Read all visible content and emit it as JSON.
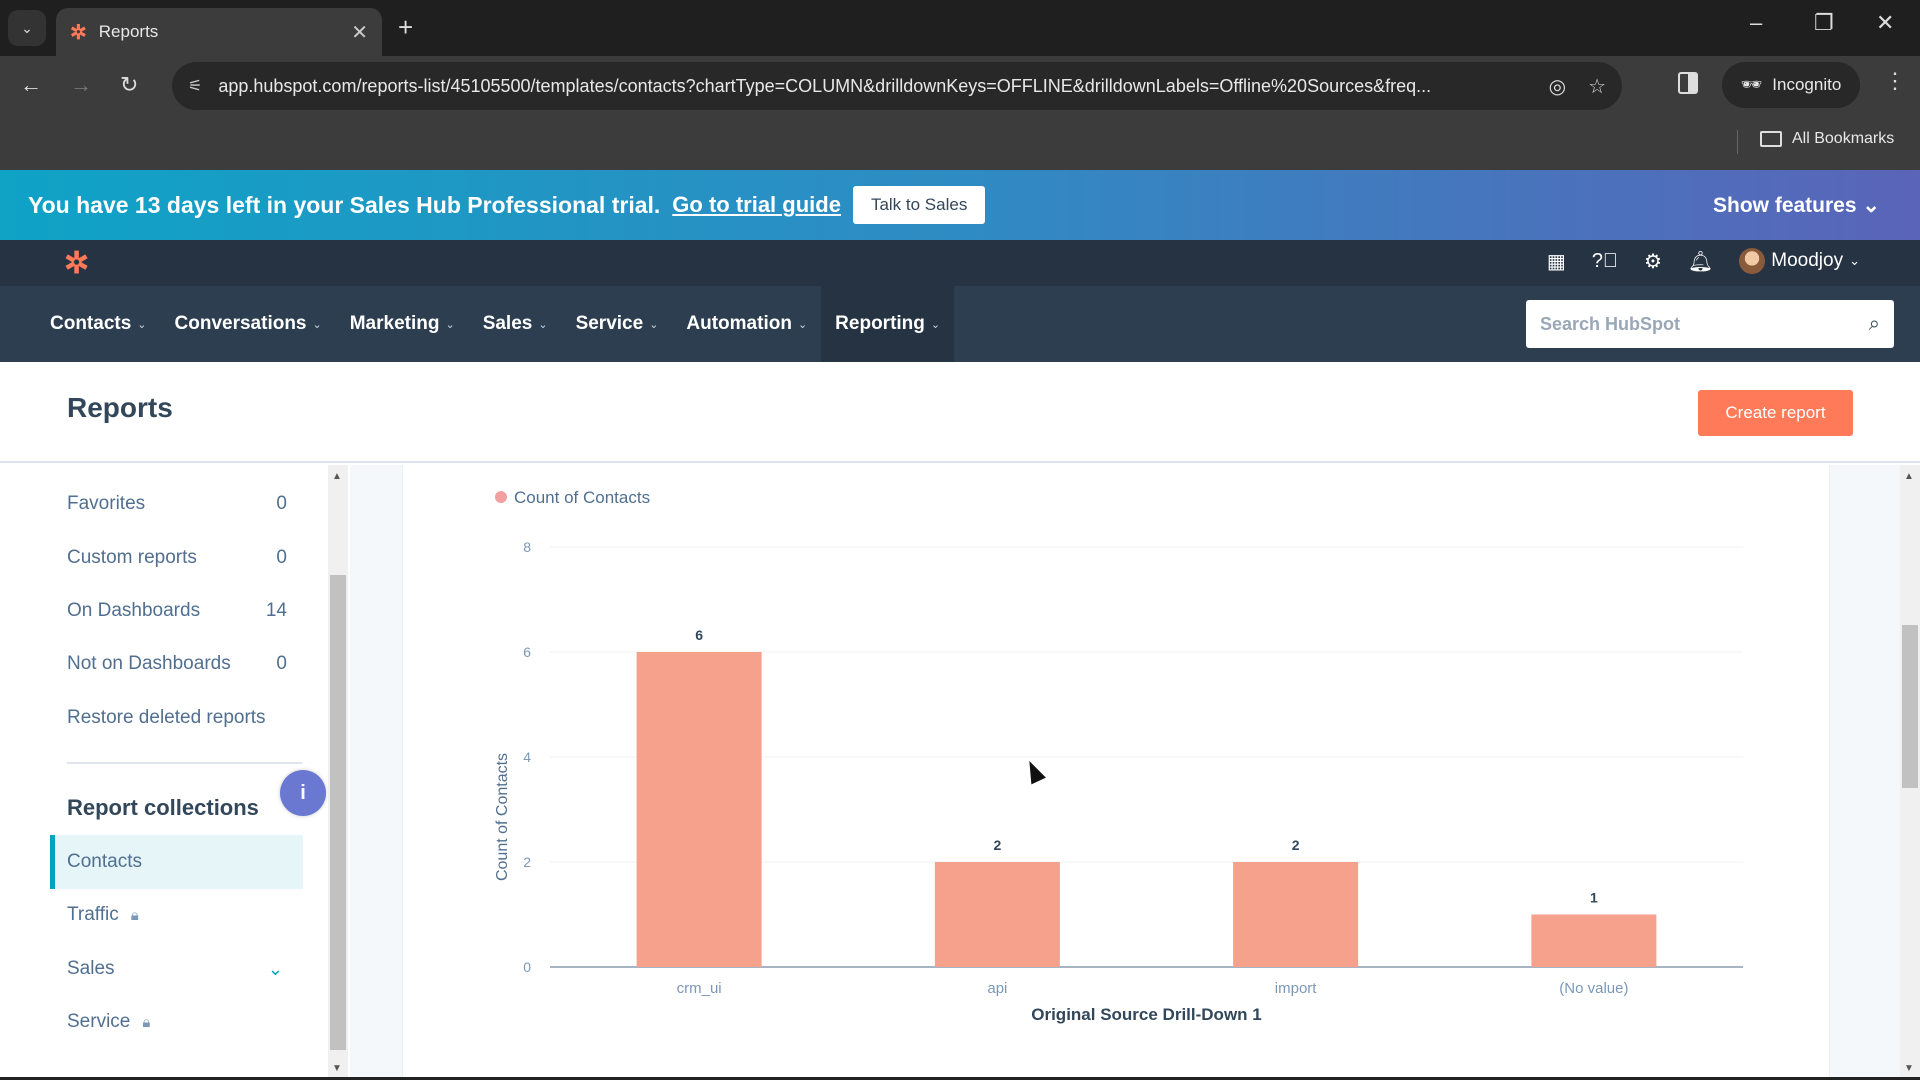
{
  "browser": {
    "tab_title": "Reports",
    "url": "app.hubspot.com/reports-list/45105500/templates/contacts?chartType=COLUMN&drilldownKeys=OFFLINE&drilldownLabels=Offline%20Sources&freq...",
    "incognito_label": "Incognito",
    "bookmarks_label": "All Bookmarks"
  },
  "trial_banner": {
    "message": "You have 13 days left in your Sales Hub Professional trial.",
    "guide_link": "Go to trial guide",
    "talk_button": "Talk to Sales",
    "show_features": "Show features"
  },
  "topbar": {
    "user_name": "Moodjoy"
  },
  "nav": {
    "items": [
      {
        "label": "Contacts"
      },
      {
        "label": "Conversations"
      },
      {
        "label": "Marketing"
      },
      {
        "label": "Sales"
      },
      {
        "label": "Service"
      },
      {
        "label": "Automation"
      },
      {
        "label": "Reporting"
      }
    ],
    "search_placeholder": "Search HubSpot"
  },
  "page": {
    "title": "Reports",
    "create_button": "Create report"
  },
  "sidebar": {
    "filters": [
      {
        "label": "Favorites",
        "count": "0"
      },
      {
        "label": "Custom reports",
        "count": "0"
      },
      {
        "label": "On Dashboards",
        "count": "14"
      },
      {
        "label": "Not on Dashboards",
        "count": "0"
      },
      {
        "label": "Restore deleted reports",
        "count": ""
      }
    ],
    "collections_heading": "Report collections",
    "info_badge": "i",
    "collections": [
      {
        "label": "Contacts",
        "active": true,
        "locked": false
      },
      {
        "label": "Traffic",
        "active": false,
        "locked": true
      },
      {
        "label": "Sales",
        "active": false,
        "locked": false,
        "expandable": true
      },
      {
        "label": "Service",
        "active": false,
        "locked": true
      }
    ]
  },
  "chart_data": {
    "type": "bar",
    "title": "",
    "legend": [
      "Count of Contacts"
    ],
    "legend_position": "top-left",
    "categories": [
      "crm_ui",
      "api",
      "import",
      "(No value)"
    ],
    "values": [
      6,
      2,
      2,
      1
    ],
    "data_labels": [
      "6",
      "2",
      "2",
      "1"
    ],
    "xlabel": "Original Source Drill-Down 1",
    "ylabel": "Count of Contacts",
    "ylim": [
      0,
      8
    ],
    "yticks": [
      "0",
      "2",
      "4",
      "6",
      "8"
    ],
    "grid": true,
    "bar_color": "#f5a18c"
  }
}
